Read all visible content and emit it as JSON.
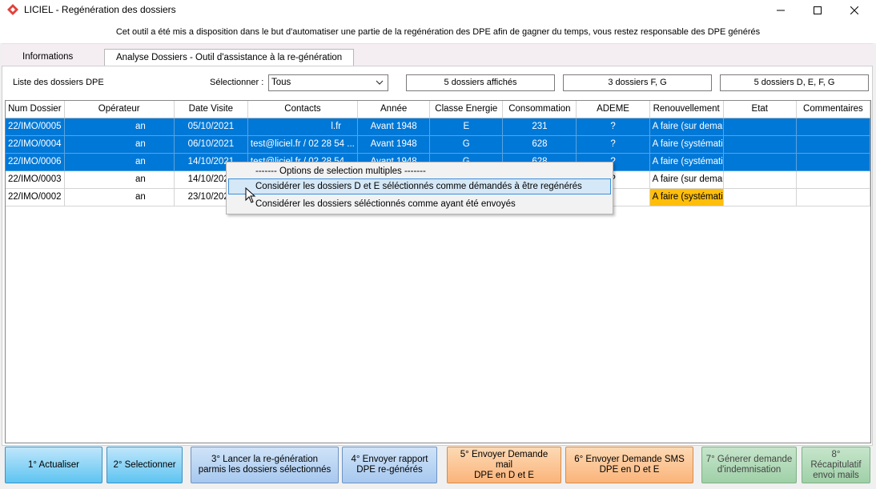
{
  "window": {
    "title": "LICIEL - Regénération des dossiers",
    "minimize": "—",
    "maximize": "☐",
    "close": "✕"
  },
  "notice": "Cet outil a été mis a disposition dans le but d'automatiser une partie de la regénération des DPE afin de gagner du temps, vous restez responsable des DPE générés",
  "tabs": [
    {
      "label": "Informations",
      "active": false
    },
    {
      "label": "Analyse Dossiers - Outil d'assistance à la re-génération",
      "active": true
    }
  ],
  "toolbar": {
    "list_label": "Liste des dossiers DPE",
    "select_label": "Sélectionner :",
    "select_value": "Tous",
    "count_shown": "5 dossiers affichés",
    "count_fg": "3 dossiers F, G",
    "count_defg": "5 dossiers D, E, F, G"
  },
  "table": {
    "headers": [
      "Num Dossier",
      "Opérateur",
      "Date Visite",
      "Contacts",
      "Année",
      "Classe Energie",
      "Consommation",
      "ADEME",
      "Renouvellement",
      "Etat",
      "Commentaires"
    ],
    "rows": [
      {
        "num": "22/IMO/0005",
        "op": "an",
        "date": "05/10/2021",
        "contacts": "l.fr",
        "annee": "Avant 1948",
        "classe": "E",
        "conso": "231",
        "ademe": "?",
        "renouv": "A faire (sur demande)",
        "etat": "",
        "comm": ""
      },
      {
        "num": "22/IMO/0004",
        "op": "an",
        "date": "06/10/2021",
        "contacts": "test@liciel.fr  /  02 28 54 ...",
        "annee": "Avant 1948",
        "classe": "G",
        "conso": "628",
        "ademe": "?",
        "renouv": "A faire (systématique)",
        "etat": "",
        "comm": ""
      },
      {
        "num": "22/IMO/0006",
        "op": "an",
        "date": "14/10/2021",
        "contacts": "test@liciel.fr  /  02 28 54 ...",
        "annee": "Avant 1948",
        "classe": "G",
        "conso": "628",
        "ademe": "?",
        "renouv": "A faire (systématique)",
        "etat": "",
        "comm": ""
      },
      {
        "num": "22/IMO/0003",
        "op": "an",
        "date": "14/10/2021",
        "contacts": "",
        "annee": "",
        "classe": "",
        "conso": "",
        "ademe": "?",
        "renouv": "A faire (sur demande)",
        "etat": "",
        "comm": ""
      },
      {
        "num": "22/IMO/0002",
        "op": "an",
        "date": "23/10/2021",
        "contacts": "",
        "annee": "",
        "classe": "",
        "conso": "",
        "ademe": "",
        "renouv": "A faire (systématique)",
        "etat": "",
        "comm": ""
      }
    ]
  },
  "context_menu": {
    "header": "------- Options de selection multiples -------",
    "item1": "Considérer les dossiers D et E séléctionnés comme démandés à être regénérés",
    "item2": "Considérer les dossiers séléctionnés comme ayant été envoyés"
  },
  "buttons": {
    "b1": "1° Actualiser",
    "b2": "2° Selectionner",
    "b3_l1": "3° Lancer la re-génération",
    "b3_l2": "parmis les dossiers sélectionnés",
    "b4_l1": "4° Envoyer rapport",
    "b4_l2": "DPE re-générés",
    "b5_l1": "5° Envoyer Demande mail",
    "b5_l2": "DPE en D et E",
    "b6_l1": "6° Envoyer Demande SMS",
    "b6_l2": "DPE en D et E",
    "b7_l1": "7° Génerer demande",
    "b7_l2": "d'indemnisation",
    "b8_l1": "8° Récapitulatif",
    "b8_l2": "envoi mails"
  },
  "colors": {
    "selection": "#0078d7",
    "highlight_orange": "#ffbe0c",
    "logo_red": "#e0423b"
  }
}
